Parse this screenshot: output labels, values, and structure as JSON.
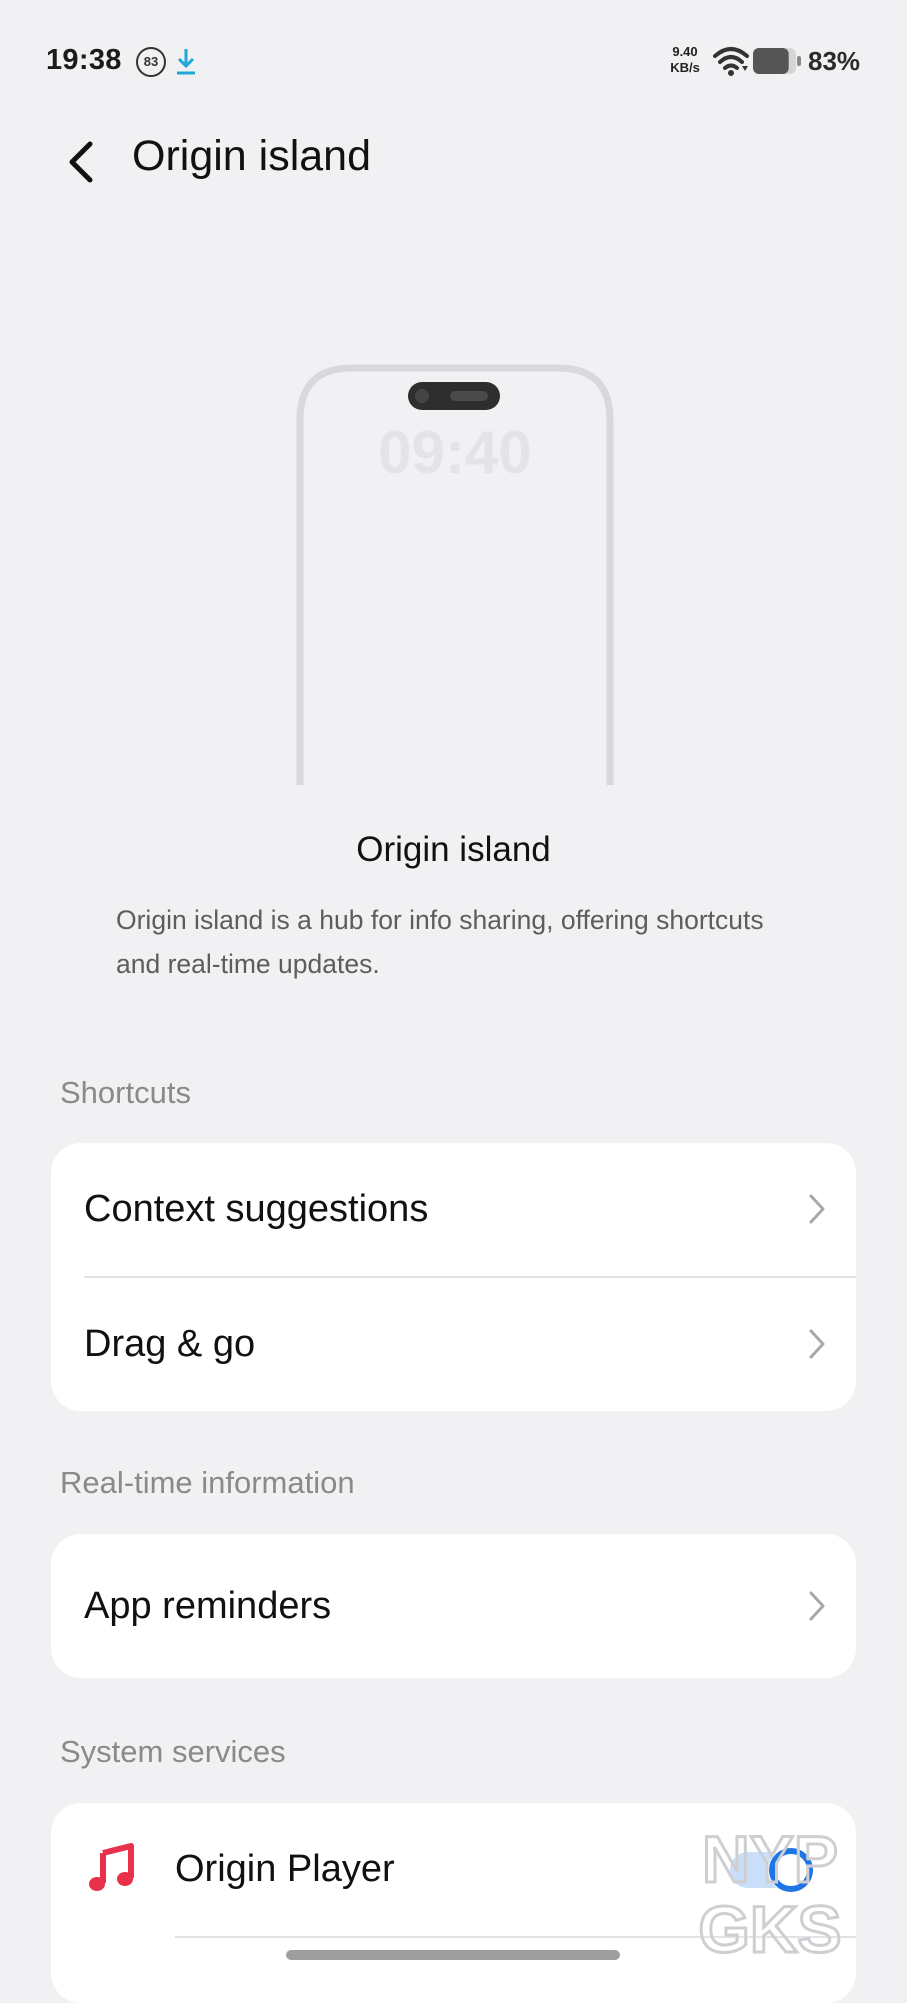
{
  "status_bar": {
    "time": "19:38",
    "notification_badge": "83",
    "download_icon": "download-arrow-icon",
    "net_speed_value": "9.40",
    "net_speed_unit": "KB/s",
    "wifi_icon": "wifi-icon",
    "battery_icon": "battery-icon",
    "battery_percent": "83%",
    "battery_level": 0.83
  },
  "header": {
    "back_icon": "chevron-left-icon",
    "title": "Origin island"
  },
  "illustration": {
    "clock": "09:40"
  },
  "hero": {
    "title": "Origin island",
    "description": "Origin island is a hub for info sharing, offering shortcuts and real-time updates."
  },
  "sections": {
    "shortcuts": {
      "label": "Shortcuts",
      "items": [
        {
          "label": "Context suggestions"
        },
        {
          "label": "Drag & go"
        }
      ]
    },
    "realtime": {
      "label": "Real-time information",
      "items": [
        {
          "label": "App reminders"
        }
      ]
    },
    "system": {
      "label": "System services",
      "items": [
        {
          "label": "Origin Player",
          "icon": "music-note-icon",
          "toggle_on": true
        }
      ]
    }
  },
  "colors": {
    "background": "#f1f1f3",
    "card": "#ffffff",
    "accent": "#1f74e6",
    "music_icon": "#e8324b"
  },
  "watermark": {
    "line1": "NYP",
    "line2": "GKS"
  }
}
